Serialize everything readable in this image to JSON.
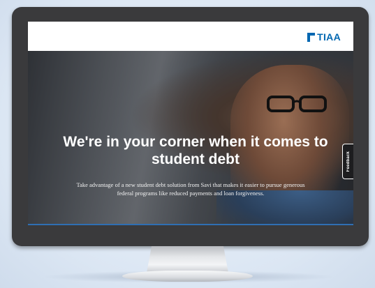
{
  "site": {
    "logo_text": "TIAA",
    "brand_color": "#0067b1"
  },
  "hero": {
    "title": "We're in your corner when it comes to student debt",
    "body": "Take advantage of a new student debt solution from Savi that makes it easier to pursue generous federal programs like reduced payments and loan forgiveness."
  },
  "feedback": {
    "label": "Feedback"
  },
  "icons": {
    "logo_mark": "tiaa-logo-icon"
  }
}
